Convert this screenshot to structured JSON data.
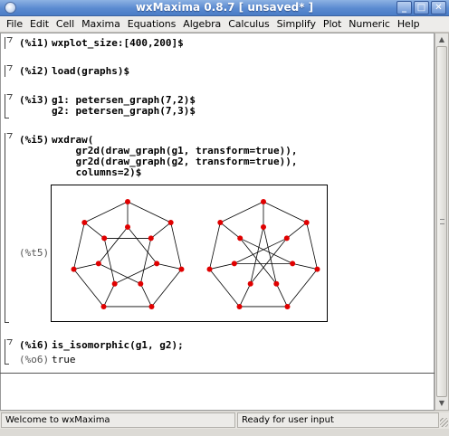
{
  "window": {
    "title": "wxMaxima 0.8.7 [ unsaved* ]",
    "minimize_glyph": "_",
    "maximize_glyph": "□",
    "close_glyph": "✕"
  },
  "menu": [
    "File",
    "Edit",
    "Cell",
    "Maxima",
    "Equations",
    "Algebra",
    "Calculus",
    "Simplify",
    "Plot",
    "Numeric",
    "Help"
  ],
  "cells": [
    {
      "label": "(%i1)",
      "code": [
        "wxplot_size:[400,200]$"
      ]
    },
    {
      "label": "(%i2)",
      "code": [
        "load(graphs)$"
      ]
    },
    {
      "label": "(%i3)",
      "code": [
        "g1: petersen_graph(7,2)$",
        "g2: petersen_graph(7,3)$"
      ]
    },
    {
      "label": "(%i5)",
      "code": [
        "wxdraw(",
        "    gr2d(draw_graph(g1, transform=true)),",
        "    gr2d(draw_graph(g2, transform=true)),",
        "    columns=2)$"
      ]
    },
    {
      "label": "(%i6)",
      "code": [
        "is_isomorphic(g1, g2);"
      ]
    }
  ],
  "plot_output": {
    "label": "(%t5)",
    "vertex_color": "#e00000",
    "edge_color": "#000000"
  },
  "result": {
    "label": "(%o6)",
    "value": "true"
  },
  "status": {
    "left": "Welcome to wxMaxima",
    "right": "Ready for user input"
  },
  "scrollbar": {
    "up_glyph": "▲",
    "down_glyph": "▼"
  }
}
